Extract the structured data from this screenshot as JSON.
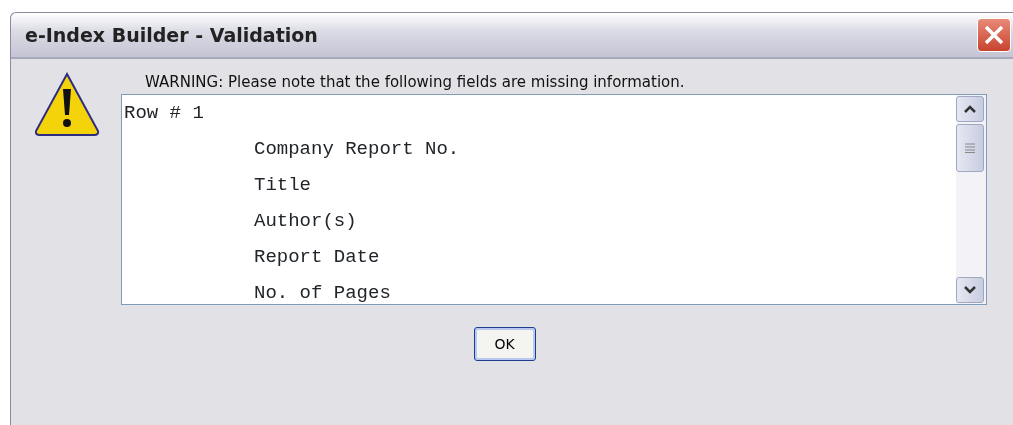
{
  "window": {
    "title": "e-Index Builder - Validation"
  },
  "message": "WARNING: Please note that the following fields are missing information.",
  "listing": [
    {
      "label": "Row # 1",
      "children": [
        {
          "label": "Company Report No."
        },
        {
          "label": "Title"
        },
        {
          "label": "Author(s)"
        },
        {
          "label": "Report Date"
        },
        {
          "label": "No. of Pages"
        }
      ]
    }
  ],
  "buttons": [
    "OK"
  ]
}
